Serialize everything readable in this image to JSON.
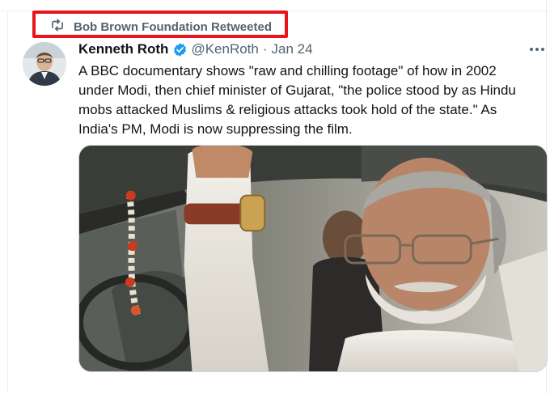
{
  "retweet": {
    "icon": "retweet-icon",
    "label": "Bob Brown Foundation Retweeted",
    "highlight_color": "#e8141c"
  },
  "tweet": {
    "author_name": "Kenneth Roth",
    "verified_icon": "verified-badge-icon",
    "handle": "@KenRoth",
    "separator": "·",
    "date": "Jan 24",
    "text_lines": [
      "A BBC documentary shows \"raw and chilling footage\" of how in 2002",
      "under Modi, then chief minister of Gujarat, \"the police stood by as Hindu",
      "mobs attacked Muslims & religious attacks took hold of the state.\" As",
      "India's PM, Modi is now suppressing the film."
    ],
    "media_description_icon": "photo-image"
  },
  "colors": {
    "text_primary": "#0f1419",
    "text_secondary": "#536471",
    "verified_blue": "#1d9bf0"
  }
}
